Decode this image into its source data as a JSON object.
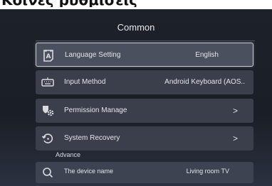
{
  "page_heading": "Κοινές ρυθμίσεις",
  "screen": {
    "title": "Common",
    "settings": [
      {
        "label": "Language Setting",
        "value": "English",
        "icon": "language-icon"
      },
      {
        "label": "Input Method",
        "value": "Android Keyboard (AOS..",
        "icon": "keyboard-icon"
      },
      {
        "label": "Permission Manage",
        "value": ">",
        "icon": "permission-gear-icon"
      },
      {
        "label": "System Recovery",
        "value": ">",
        "icon": "system-recovery-icon"
      }
    ],
    "advance_section": "Advance",
    "advance_items": [
      {
        "label": "The device name",
        "value": "Living room TV",
        "icon": "search-icon"
      }
    ]
  },
  "colors": {
    "background": "#1d2129",
    "row": "#3a3f4b",
    "row_focused": "#4a505d",
    "text": "#e3e5ea"
  }
}
